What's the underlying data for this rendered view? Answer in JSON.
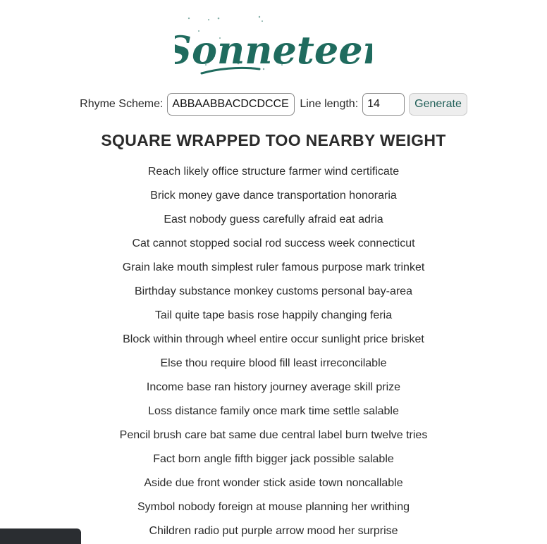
{
  "logo": {
    "text": "Sonneteer"
  },
  "controls": {
    "rhyme_label": "Rhyme Scheme:",
    "rhyme_value": "ABBAABBACDCDCCED",
    "length_label": "Line length:",
    "length_value": "14",
    "generate_label": "Generate"
  },
  "poem": {
    "title": "SQUARE WRAPPED TOO NEARBY WEIGHT",
    "lines": [
      "Reach likely office structure farmer wind certificate",
      "Brick money gave dance transportation honoraria",
      "East nobody guess carefully afraid eat adria",
      "Cat cannot stopped social rod success week connecticut",
      "Grain lake mouth simplest ruler famous purpose mark trinket",
      "Birthday substance monkey customs personal bay-area",
      "Tail quite tape basis rose happily changing feria",
      "Block within through wheel entire occur sunlight price brisket",
      "Else thou require blood fill least irreconcilable",
      "Income base ran history journey average skill prize",
      "Loss distance family once mark time settle salable",
      "Pencil brush care bat same due central label burn twelve tries",
      "Fact born angle fifth bigger jack possible salable",
      "Aside due front wonder stick aside town noncallable",
      "Symbol nobody foreign at mouse planning her writhing",
      "Children radio put purple arrow mood her surprise"
    ]
  },
  "colors": {
    "logo": "#1f6b5e",
    "button_text": "#1f5e57",
    "button_bg": "#eeeeee",
    "text": "#2b2b2b"
  }
}
